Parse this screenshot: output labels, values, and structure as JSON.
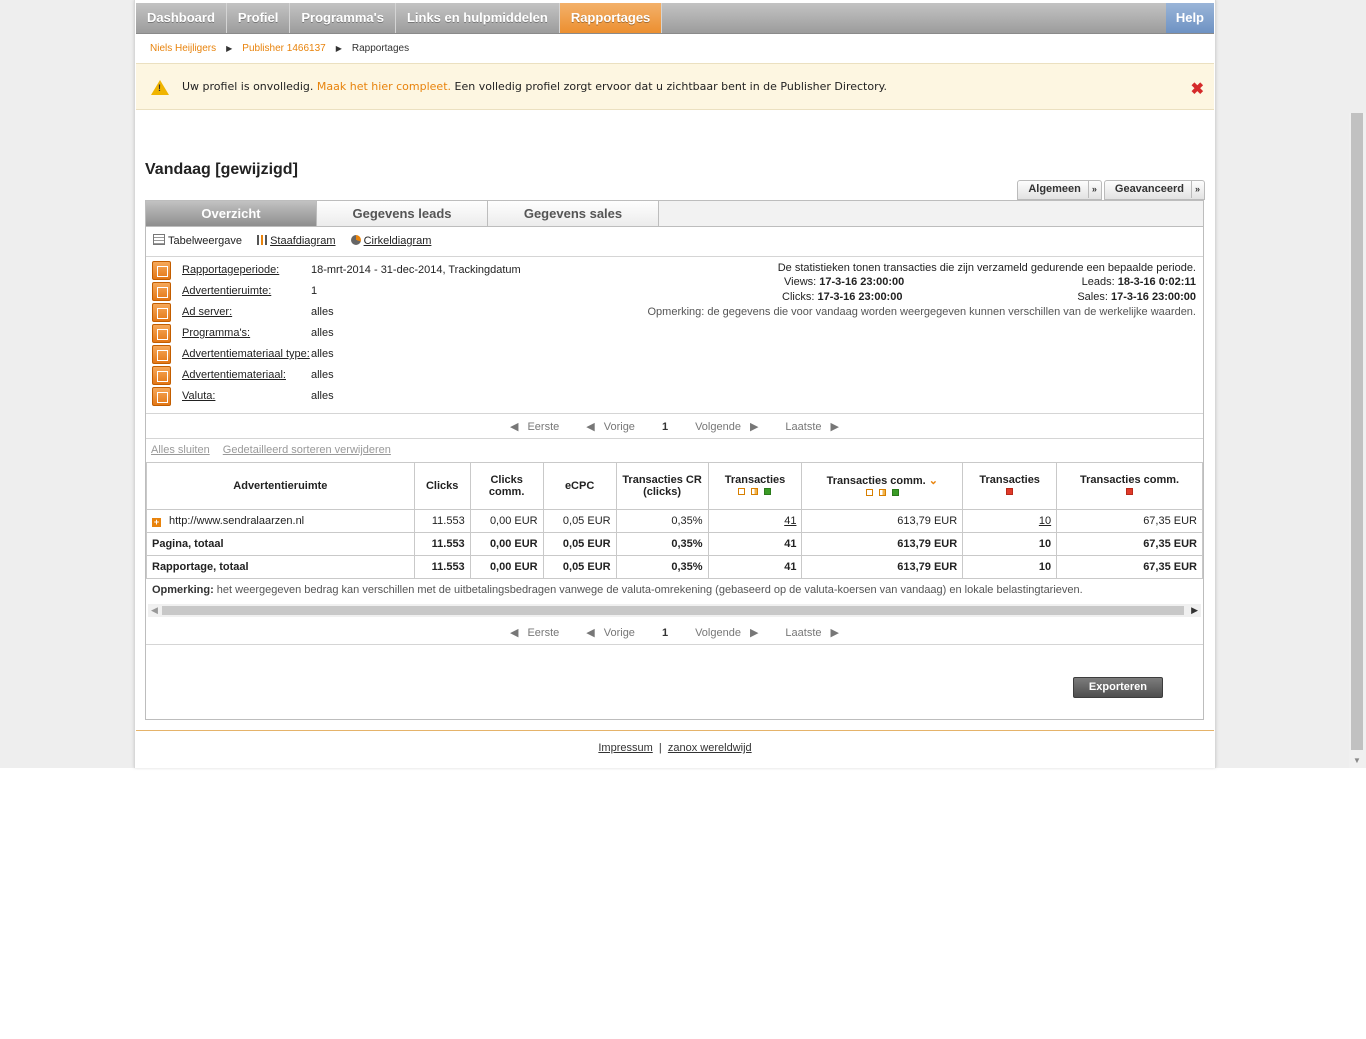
{
  "nav": {
    "items": [
      "Dashboard",
      "Profiel",
      "Programma's",
      "Links en hulpmiddelen",
      "Rapportages"
    ],
    "help": "Help"
  },
  "breadcrumb": [
    "Niels Heijligers",
    "Publisher 1466137",
    "Rapportages"
  ],
  "notice": {
    "before": "Uw profiel is onvolledig.",
    "link": "Maak het hier compleet.",
    "after": "Een volledig profiel zorgt ervoor dat u zichtbaar bent in de Publisher Directory."
  },
  "title": "Vandaag [gewijzigd]",
  "view_buttons": [
    "Algemeen",
    "Geavanceerd"
  ],
  "tabs": [
    "Overzicht",
    "Gegevens leads",
    "Gegevens sales"
  ],
  "views": [
    "Tabelweergave",
    "Staafdiagram",
    "Cirkeldiagram"
  ],
  "params": [
    {
      "key": "Rapportageperiode:",
      "value": "18-mrt-2014 - 31-dec-2014, Trackingdatum"
    },
    {
      "key": "Advertentieruimte:",
      "value": "1"
    },
    {
      "key": "Ad server:",
      "value": "alles"
    },
    {
      "key": "Programma's:",
      "value": "alles"
    },
    {
      "key": "Advertentiemateriaal type:",
      "value": "alles"
    },
    {
      "key": "Advertentiemateriaal:",
      "value": "alles"
    },
    {
      "key": "Valuta:",
      "value": "alles"
    }
  ],
  "stats": {
    "intro": "De statistieken tonen transacties die zijn verzameld gedurende een bepaalde periode.",
    "views_label": "Views:",
    "views_value": "17-3-16 23:00:00",
    "clicks_label": "Clicks:",
    "clicks_value": "17-3-16 23:00:00",
    "leads_label": "Leads:",
    "leads_value": "18-3-16 0:02:11",
    "sales_label": "Sales:",
    "sales_value": "17-3-16 23:00:00",
    "note": "Opmerking: de gegevens die voor vandaag worden weergegeven kunnen verschillen van de werkelijke waarden."
  },
  "pager": {
    "first": "Eerste",
    "prev": "Vorige",
    "page": "1",
    "next": "Volgende",
    "last": "Laatste"
  },
  "links": [
    "Alles sluiten",
    "Gedetailleerd sorteren verwijderen"
  ],
  "table": {
    "headers": [
      "Advertentieruimte",
      "Clicks",
      "Clicks comm.",
      "eCPC",
      "Transacties CR (clicks)",
      "Transacties",
      "Transacties comm.",
      "Transacties",
      "Transacties comm."
    ],
    "rows": [
      {
        "cells": [
          "http://www.sendralaarzen.nl",
          "11.553",
          "0,00 EUR",
          "0,05 EUR",
          "0,35%",
          "41",
          "613,79 EUR",
          "10",
          "67,35 EUR"
        ]
      },
      {
        "cells": [
          "Pagina, totaal",
          "11.553",
          "0,00 EUR",
          "0,05 EUR",
          "0,35%",
          "41",
          "613,79 EUR",
          "10",
          "67,35 EUR"
        ]
      },
      {
        "cells": [
          "Rapportage, totaal",
          "11.553",
          "0,00 EUR",
          "0,05 EUR",
          "0,35%",
          "41",
          "613,79 EUR",
          "10",
          "67,35 EUR"
        ]
      }
    ]
  },
  "remark": {
    "label": "Opmerking:",
    "text": "het weergegeven bedrag kan verschillen met de uitbetalingsbedragen vanwege de valuta-omrekening (gebaseerd op de valuta-koersen van vandaag) en lokale belastingtarieven."
  },
  "export_label": "Exporteren",
  "footer": {
    "impressum": "Impressum",
    "separator": "|",
    "worldwide": "zanox wereldwijd"
  },
  "colors": {
    "accent": "#e8830c",
    "help": "#7a9cc9",
    "warning_bg": "#fdf6e1",
    "close": "#d52a2a"
  }
}
